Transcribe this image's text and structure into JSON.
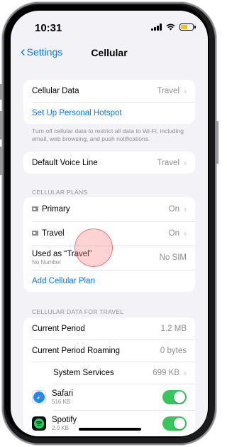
{
  "status": {
    "time": "10:31"
  },
  "nav": {
    "back_label": "Settings",
    "title": "Cellular"
  },
  "group1": {
    "cellular_data_label": "Cellular Data",
    "cellular_data_value": "Travel",
    "hotspot_label": "Set Up Personal Hotspot",
    "note": "Turn off cellular data to restrict all data to Wi-Fi, including email, web browsing, and push notifications."
  },
  "group2": {
    "voice_label": "Default Voice Line",
    "voice_value": "Travel"
  },
  "plans": {
    "header": "CELLULAR PLANS",
    "primary_label": "Primary",
    "primary_value": "On",
    "travel_label": "Travel",
    "travel_value": "On",
    "used_as_label": "Used as “Travel”",
    "used_as_sub": "No Number",
    "used_as_value": "No SIM",
    "add_label": "Add Cellular Plan"
  },
  "usage": {
    "header": "CELLULAR DATA FOR TRAVEL",
    "current_label": "Current Period",
    "current_value": "1.2 MB",
    "roaming_label": "Current Period Roaming",
    "roaming_value": "0 bytes",
    "system_label": "System Services",
    "system_value": "699 KB",
    "apps": [
      {
        "name": "Safari",
        "size": "516 KB",
        "icon": "safari-icon",
        "on": true
      },
      {
        "name": "Spotify",
        "size": "2.0 KB",
        "icon": "spotify-icon",
        "on": true
      }
    ]
  },
  "colors": {
    "accent": "#007aff",
    "toggle_on": "#34c759",
    "background": "#f2f2f7"
  }
}
